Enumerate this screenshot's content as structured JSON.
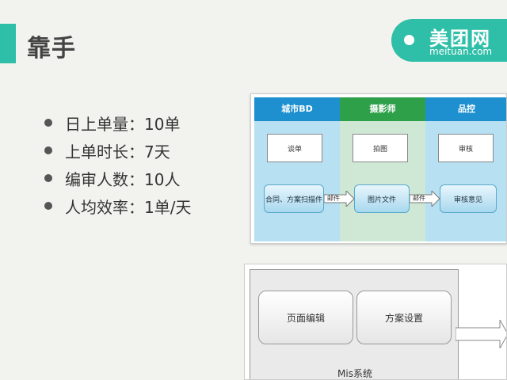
{
  "slide": {
    "title": "靠手",
    "bullets": [
      "日上单量：10单",
      "上单时长：7天",
      "编审人数：10人",
      "人均效率：1单/天"
    ]
  },
  "logo": {
    "cn": "美团网",
    "en": "meituan.com"
  },
  "flow_diagram": {
    "lanes": [
      "城市BD",
      "摄影师",
      "品控"
    ],
    "boxes": [
      "谈单",
      "拍图",
      "审核"
    ],
    "steps": [
      "合同、方案扫描件",
      "图片文件",
      "审核意见"
    ],
    "arrows": [
      "邮件",
      "邮件"
    ]
  },
  "mis_diagram": {
    "buttons": [
      "页面编辑",
      "方案设置"
    ],
    "label": "Mis系统"
  },
  "colors": {
    "accent": "#2fbfa8",
    "lane_blue_head": "#1e90d0",
    "lane_green_head": "#2ea04a",
    "lane_blue_body": "#b7e0f2",
    "lane_green_body": "#cfe8d6"
  }
}
